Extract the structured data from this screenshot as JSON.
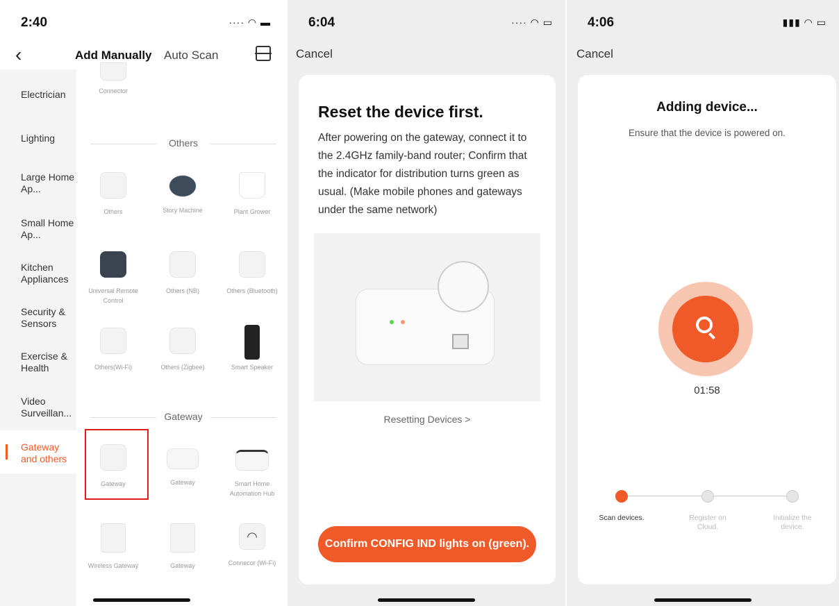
{
  "panel1": {
    "time": "2:40",
    "tabs": {
      "add_manually": "Add Manually",
      "auto_scan": "Auto Scan"
    },
    "sidebar": [
      {
        "label": "Electrician"
      },
      {
        "label": "Lighting"
      },
      {
        "label": "Large Home Ap..."
      },
      {
        "label": "Small Home Ap..."
      },
      {
        "label": "Kitchen Appliances"
      },
      {
        "label": "Security & Sensors"
      },
      {
        "label": "Exercise & Health"
      },
      {
        "label": "Video Surveillan..."
      },
      {
        "label": "Gateway and others"
      }
    ],
    "top_item": "Connector",
    "sections": {
      "others": "Others",
      "gateway": "Gateway"
    },
    "devices": [
      {
        "name": "Others"
      },
      {
        "name": "Story Machine"
      },
      {
        "name": "Plant Grower"
      },
      {
        "name": "Universal Remote Control"
      },
      {
        "name": "Others (NB)"
      },
      {
        "name": "Others (Bluetooth)"
      },
      {
        "name": "Others(Wi-Fi)"
      },
      {
        "name": "Others (Zigbee)"
      },
      {
        "name": "Smart Speaker"
      },
      {
        "name": "Gateway"
      },
      {
        "name": "Gateway"
      },
      {
        "name": "Smart Home Automation Hub"
      },
      {
        "name": "Wireless Gateway"
      },
      {
        "name": "Gateway"
      },
      {
        "name": "Connecor (Wi-Fi)"
      }
    ]
  },
  "panel2": {
    "time": "6:04",
    "cancel": "Cancel",
    "title": "Reset the device first.",
    "text": "After powering on the gateway, connect it to the 2.4GHz family-band router; Confirm that the indicator for distribution turns green as usual. (Make mobile phones and gateways under the same network)",
    "link": "Resetting Devices >",
    "button": "Confirm CONFIG IND lights on (green)."
  },
  "panel3": {
    "time": "4:06",
    "cancel": "Cancel",
    "title": "Adding device...",
    "subtitle": "Ensure that the device is powered on.",
    "timer": "01:58",
    "steps": [
      {
        "label": "Scan devices."
      },
      {
        "label": "Register on Cloud."
      },
      {
        "label": "Initialize the device."
      }
    ]
  },
  "colors": {
    "accent": "#f05a28",
    "highlight": "#e01b1b"
  }
}
